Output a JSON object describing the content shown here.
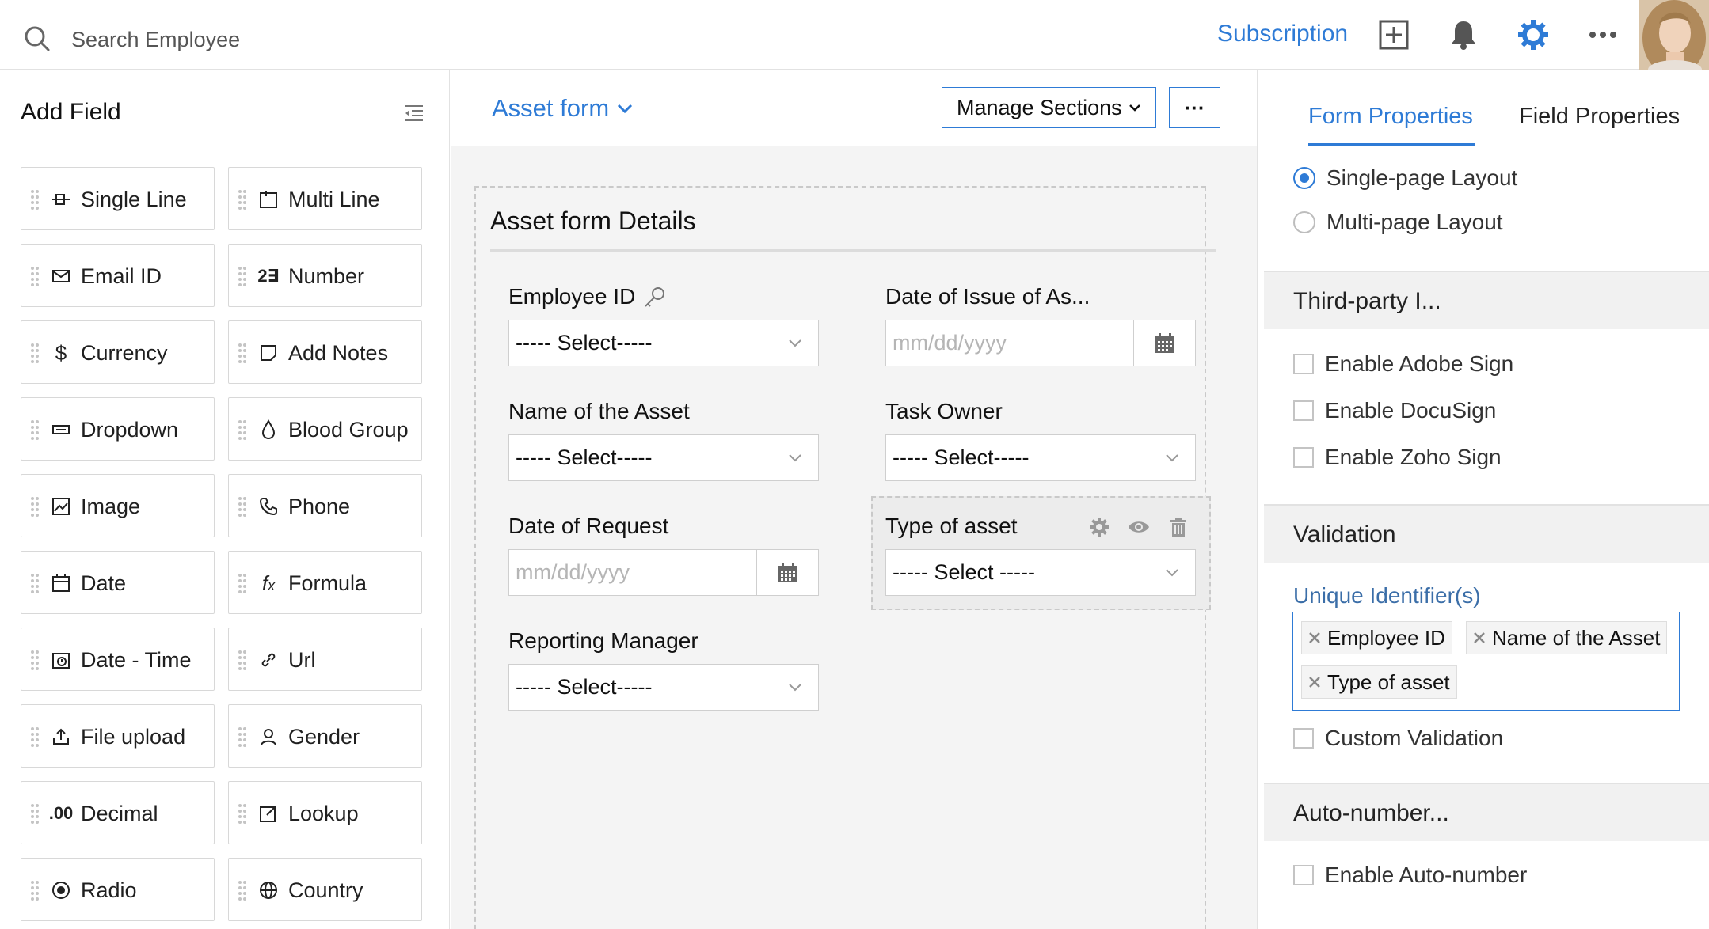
{
  "topbar": {
    "search_placeholder": "Search Employee",
    "subscription_label": "Subscription"
  },
  "left_panel": {
    "title": "Add Field",
    "fields": [
      {
        "label": "Single Line",
        "icon": "single-line-icon"
      },
      {
        "label": "Multi Line",
        "icon": "multi-line-icon"
      },
      {
        "label": "Email ID",
        "icon": "email-icon"
      },
      {
        "label": "Number",
        "icon": "number-icon"
      },
      {
        "label": "Currency",
        "icon": "currency-icon"
      },
      {
        "label": "Add Notes",
        "icon": "notes-icon"
      },
      {
        "label": "Dropdown",
        "icon": "dropdown-icon"
      },
      {
        "label": "Blood Group",
        "icon": "blood-drop-icon"
      },
      {
        "label": "Image",
        "icon": "image-icon"
      },
      {
        "label": "Phone",
        "icon": "phone-icon"
      },
      {
        "label": "Date",
        "icon": "date-icon"
      },
      {
        "label": "Formula",
        "icon": "formula-icon"
      },
      {
        "label": "Date - Time",
        "icon": "date-time-icon"
      },
      {
        "label": "Url",
        "icon": "link-icon"
      },
      {
        "label": "File upload",
        "icon": "upload-icon"
      },
      {
        "label": "Gender",
        "icon": "person-icon"
      },
      {
        "label": "Decimal",
        "icon": "decimal-icon"
      },
      {
        "label": "Lookup",
        "icon": "lookup-icon"
      },
      {
        "label": "Radio",
        "icon": "radio-icon"
      },
      {
        "label": "Country",
        "icon": "globe-icon"
      }
    ]
  },
  "center": {
    "form_name": "Asset form",
    "manage_sections_label": "Manage Sections",
    "more_label": "···",
    "section_title": "Asset form Details",
    "fields": {
      "employee_id": {
        "label": "Employee ID",
        "value": "----- Select-----"
      },
      "date_of_issue": {
        "label": "Date of Issue of As...",
        "placeholder": "mm/dd/yyyy"
      },
      "name_of_asset": {
        "label": "Name of the Asset",
        "value": "----- Select-----"
      },
      "task_owner": {
        "label": "Task Owner",
        "value": "----- Select-----"
      },
      "date_of_request": {
        "label": "Date of Request",
        "placeholder": "mm/dd/yyyy"
      },
      "type_of_asset": {
        "label": "Type of asset",
        "value": "----- Select -----"
      },
      "reporting_manager": {
        "label": "Reporting Manager",
        "value": "----- Select-----"
      }
    }
  },
  "right_panel": {
    "tabs": [
      "Form Properties",
      "Field Properties"
    ],
    "active_tab": "Form Properties",
    "layout_options": [
      {
        "label": "Single-page Layout",
        "selected": true
      },
      {
        "label": "Multi-page Layout",
        "selected": false
      }
    ],
    "third_party": {
      "title": "Third-party I...",
      "options": [
        "Enable Adobe Sign",
        "Enable DocuSign",
        "Enable Zoho Sign"
      ]
    },
    "validation": {
      "title": "Validation",
      "unique_label": "Unique Identifier(s)",
      "chips": [
        "Employee ID",
        "Name of the Asset",
        "Type of asset"
      ],
      "custom_label": "Custom Validation"
    },
    "auto_number": {
      "title": "Auto-number...",
      "option": "Enable Auto-number"
    }
  },
  "colors": {
    "accent": "#2e7bd6",
    "panel_bg": "#f4f4f4",
    "border": "#d8d8d8"
  }
}
